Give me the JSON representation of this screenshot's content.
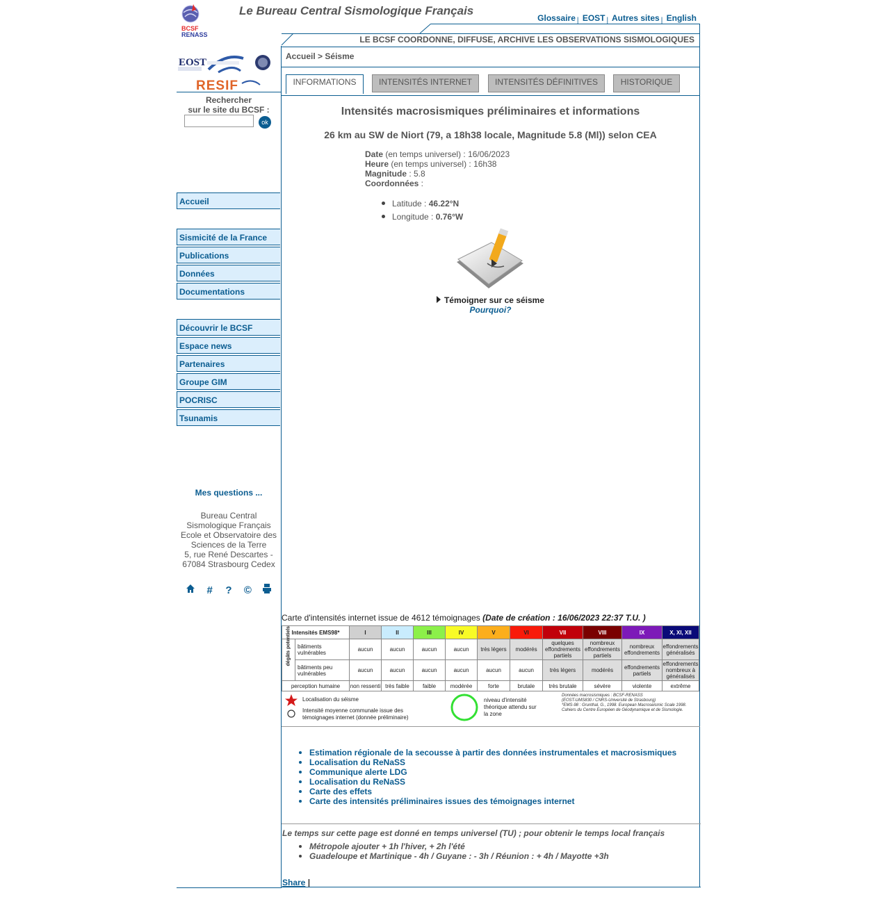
{
  "header": {
    "logo_text_1": "BCSF",
    "logo_text_2": "RENASS",
    "site_title": "Le Bureau Central Sismologique Français",
    "top_links": [
      "Glossaire",
      "EOST",
      "Autres sites",
      "English"
    ],
    "tagline": "LE BCSF COORDONNE, DIFFUSE, ARCHIVE LES OBSERVATIONS SISMOLOGIQUES"
  },
  "partners": {
    "eost": "EOST",
    "resif": "RESIF"
  },
  "search": {
    "label_1": "Rechercher",
    "label_2": "sur le site du BCSF :",
    "value": "",
    "ok": "ok"
  },
  "nav": {
    "group1": [
      "Accueil"
    ],
    "group2": [
      "Sismicité de la France",
      "Publications",
      "Données",
      "Documentations"
    ],
    "group3": [
      "Découvrir le BCSF",
      "Espace news",
      "Partenaires",
      "Groupe GIM",
      "POCRISC",
      "Tsunamis"
    ]
  },
  "sidebar_footer": {
    "questions": "Mes questions ...",
    "address": [
      "Bureau Central",
      "Sismologique Français",
      "Ecole et Observatoire des",
      "Sciences de la Terre",
      "5, rue René Descartes -",
      "67084 Strasbourg Cedex"
    ],
    "icons": [
      "home-icon",
      "hash-icon",
      "help-icon",
      "copyright-icon",
      "print-icon"
    ]
  },
  "breadcrumb": {
    "home": "Accueil",
    "sep": ">",
    "current": "Séisme"
  },
  "tabs": [
    {
      "label": "INFORMATIONS",
      "active": true
    },
    {
      "label": "INTENSITÉS INTERNET",
      "active": false
    },
    {
      "label": "INTENSITÉS DÉFINITIVES",
      "active": false
    },
    {
      "label": "HISTORIQUE",
      "active": false
    }
  ],
  "event": {
    "title": "Intensités macrosismiques préliminaires et informations",
    "subtitle": "26 km au SW de Niort (79, a 18h38 locale, Magnitude 5.8 (Ml)) selon CEA",
    "date_label": "Date",
    "date_note": " (en temps universel) : ",
    "date_value": "16/06/2023",
    "hour_label": "Heure",
    "hour_note": " (en temps universel) : ",
    "hour_value": "16h38",
    "mag_label": "Magnitude",
    "mag_value": " : 5.8",
    "coords_label": "Coordonnées",
    "coords_sep": " :",
    "lat_label": "Latitude : ",
    "lat_value": "46.22°N",
    "lon_label": "Longitude : ",
    "lon_value": "0.76°W",
    "testify": "Témoigner sur ce séisme",
    "why": "Pourquoi?"
  },
  "map": {
    "caption": "Carte d'intensités internet issue de 4612 témoignages",
    "caption_date": "(Date de création : 16/06/2023 22:37 T.U. )"
  },
  "legend": {
    "header": "Intensités EMS98*",
    "levels": [
      "I",
      "II",
      "III",
      "IV",
      "V",
      "VI",
      "VII",
      "VIII",
      "IX",
      "X, XI, XII"
    ],
    "colors": [
      "#d0d0d0",
      "#c9ecfd",
      "#8cf04a",
      "#f8fb26",
      "#fcae1c",
      "#f81a0a",
      "#c1000a",
      "#7a0000",
      "#7d1ab8",
      "#0a0a78"
    ],
    "side_label": "dégâts potentiels",
    "row1_label": "bâtiments vulnérables",
    "row1": [
      "aucun",
      "aucun",
      "aucun",
      "aucun",
      "très légers",
      "modérés",
      "quelques effondrements partiels",
      "nombreux effondrements partiels",
      "nombreux effondrements",
      "effondrements généralisés"
    ],
    "row2_label": "bâtiments peu vulnérables",
    "row2": [
      "aucun",
      "aucun",
      "aucun",
      "aucun",
      "aucun",
      "aucun",
      "très légers",
      "modérés",
      "effondrements partiels",
      "effondrements nombreux à généralisés"
    ],
    "row3_label": "perception humaine",
    "row3": [
      "non ressenti",
      "très faible",
      "faible",
      "modérée",
      "forte",
      "brutale",
      "très brutale",
      "sévère",
      "violente",
      "extrême"
    ],
    "star_label": "Localisation du séisme",
    "circle_label": "Intensité moyenne communale issue des témoignages internet (donnée préliminaire)",
    "green_label": "niveau d'intensité théorique attendu sur la zone",
    "credit1": "Données macrosismiques : BCSF-RENASS",
    "credit2": "(EOST-UMS830 / CNRS-Université de Strasbourg)",
    "credit3": "*EMS-98 : Grunthal, G., 1998. European Macroseismic Scale 1998.",
    "credit4": "Cahiers du Centre Européen de Géodynamique et de Sismologie."
  },
  "links": [
    "Estimation régionale de la secousse à partir des données instrumentales et macrosismiques",
    "Localisation du ReNaSS",
    "Communique alerte LDG",
    "Localisation du ReNaSS",
    "Carte des effets",
    "Carte des intensités préliminaires issues des témoignages internet"
  ],
  "time_note": {
    "text": "Le temps sur cette page est donné en temps universel (TU) ; pour obtenir le temps local français",
    "items": [
      "Métropole ajouter + 1h l'hiver, + 2h l'été",
      "Guadeloupe et Martinique - 4h / Guyane : - 3h / Réunion : + 4h / Mayotte +3h"
    ]
  },
  "share": {
    "label": "Share",
    "sep": "|"
  }
}
